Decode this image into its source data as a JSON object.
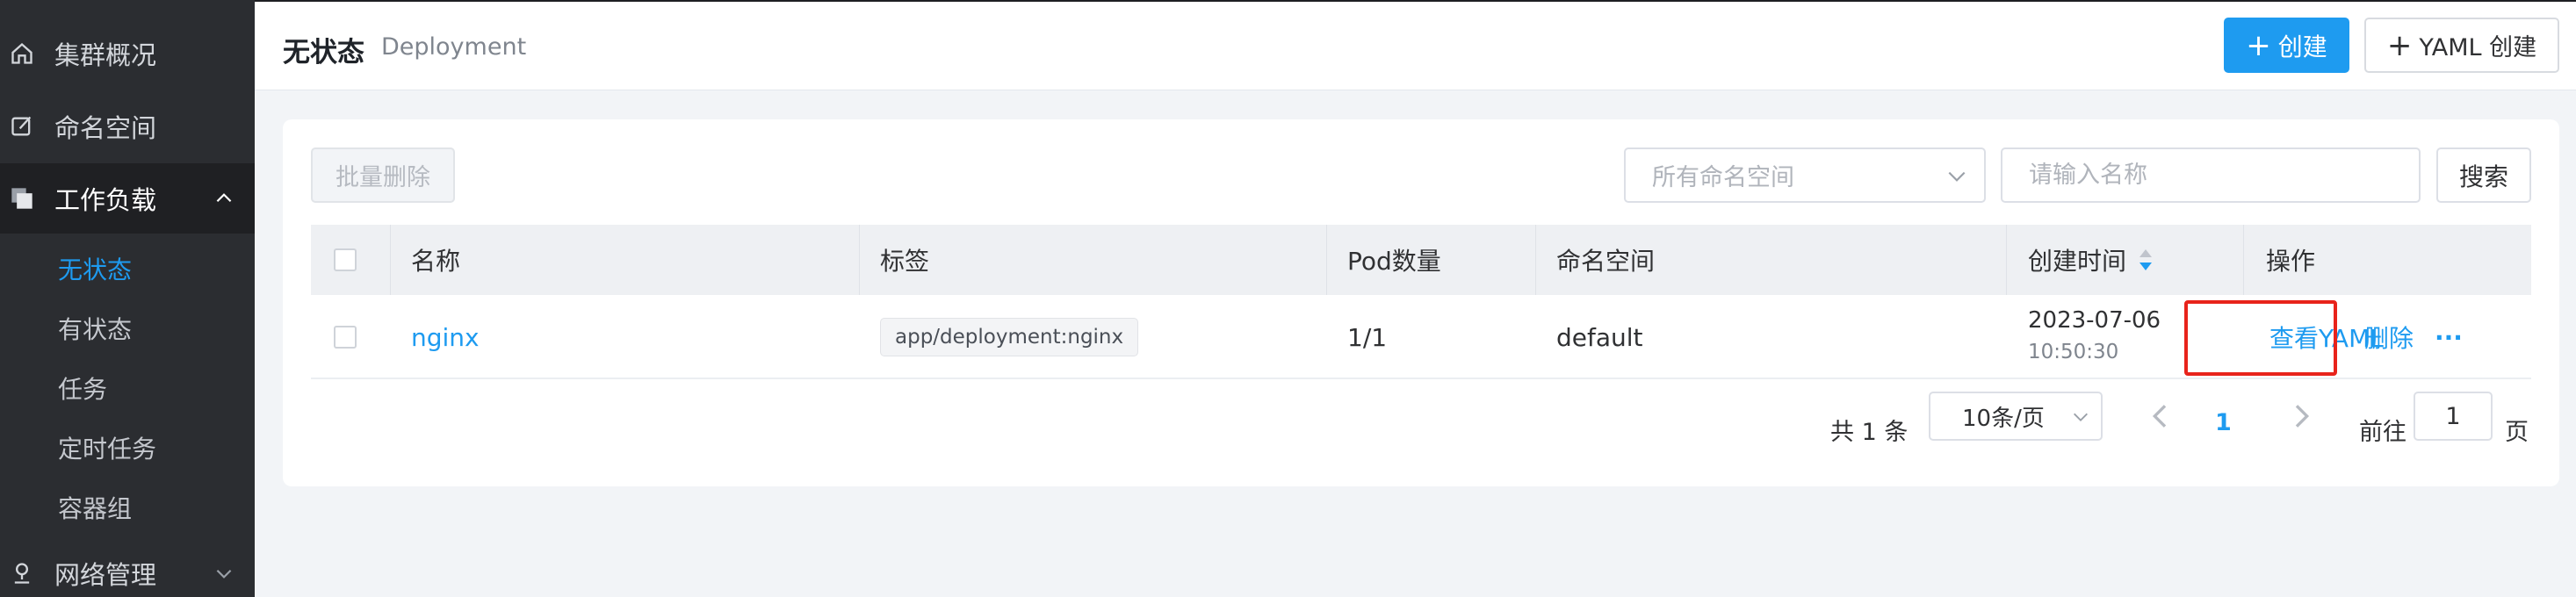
{
  "sidebar": {
    "items": [
      {
        "label": "集群概况",
        "icon": "home-icon"
      },
      {
        "label": "命名空间",
        "icon": "edit-square-icon"
      },
      {
        "label": "工作负载",
        "icon": "layers-icon",
        "expanded": true
      },
      {
        "label": "网络管理",
        "icon": "network-icon"
      }
    ],
    "workload_sub": [
      {
        "label": "无状态",
        "active": true
      },
      {
        "label": "有状态"
      },
      {
        "label": "任务"
      },
      {
        "label": "定时任务"
      },
      {
        "label": "容器组"
      }
    ]
  },
  "header": {
    "title": "无状态",
    "subtitle": "Deployment",
    "create_label": "创建",
    "yaml_create_label": "YAML 创建"
  },
  "toolbar": {
    "batch_delete_label": "批量删除",
    "namespace_placeholder": "所有命名空间",
    "name_placeholder": "请输入名称",
    "search_label": "搜索"
  },
  "table": {
    "columns": [
      "名称",
      "标签",
      "Pod数量",
      "命名空间",
      "创建时间",
      "操作"
    ],
    "rows": [
      {
        "name": "nginx",
        "label": "app/deployment:nginx",
        "pods": "1/1",
        "namespace": "default",
        "created_date": "2023-07-06",
        "created_time": "10:50:30",
        "actions": [
          "查看YAML",
          "删除",
          "···"
        ]
      }
    ]
  },
  "pagination": {
    "total_text": "共 1 条",
    "page_size": "10条/页",
    "current_page": "1",
    "goto_label": "前往",
    "goto_value": "1",
    "page_suffix": "页"
  },
  "colors": {
    "accent": "#1e9bf0",
    "sidebar_bg": "#2b2d31",
    "highlight": "#e8231b"
  }
}
